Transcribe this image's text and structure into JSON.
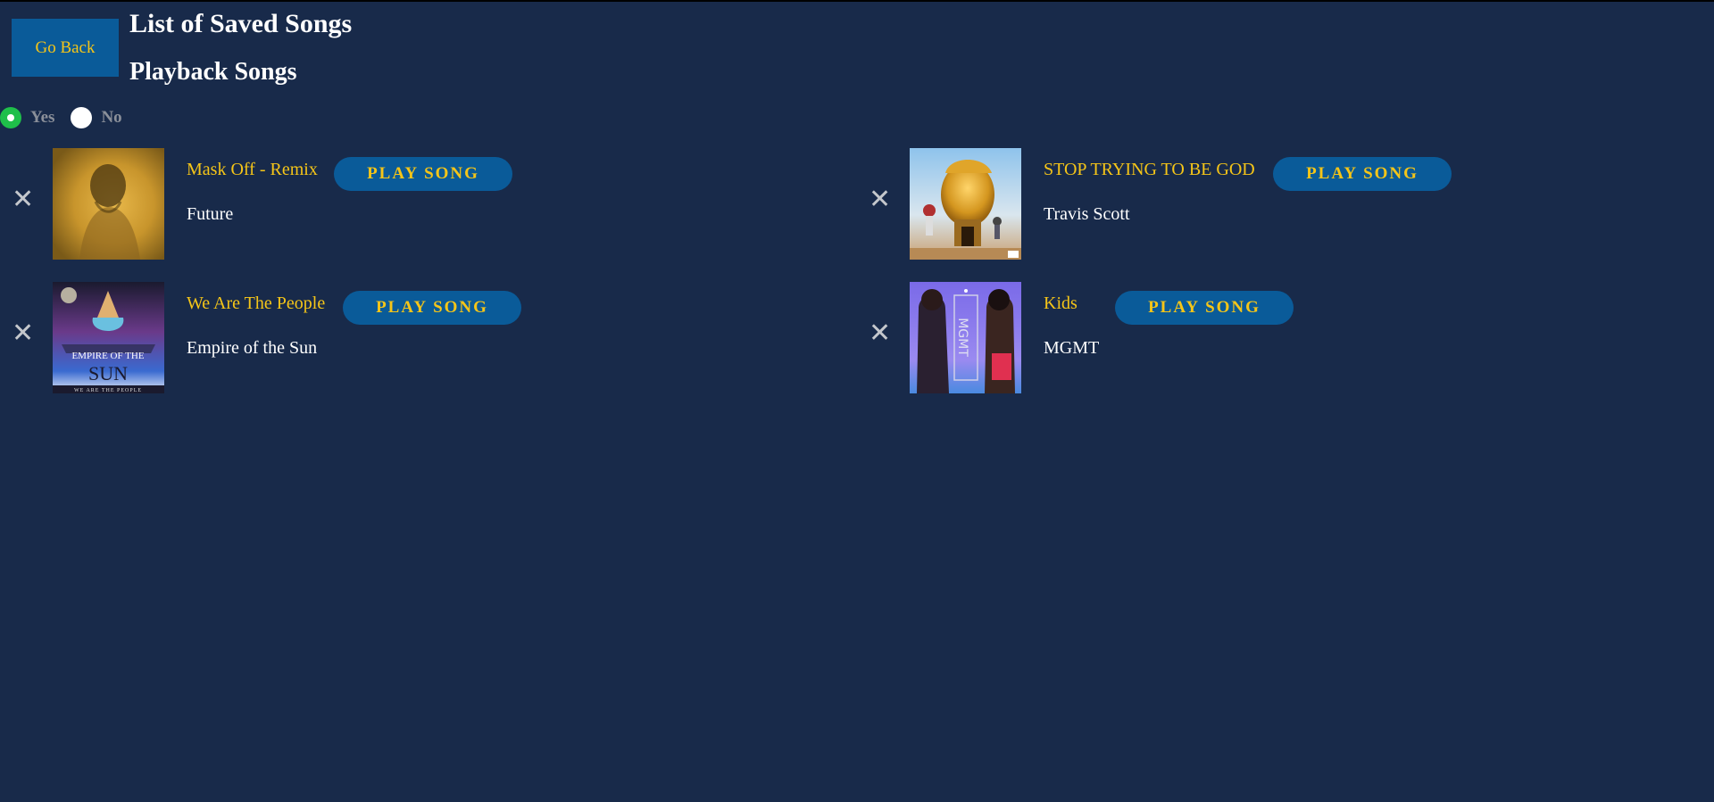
{
  "header": {
    "go_back_label": "Go Back",
    "title": "List of Saved Songs",
    "subtitle": "Playback Songs"
  },
  "playback": {
    "options": [
      {
        "label": "Yes",
        "selected": true
      },
      {
        "label": "No",
        "selected": false
      }
    ]
  },
  "songs": [
    {
      "name": "Mask Off - Remix",
      "artist": "Future",
      "play_label": "PLAY SONG",
      "remove_icon": "close-icon",
      "cover": "album-cover-mask-off"
    },
    {
      "name": "STOP TRYING TO BE GOD",
      "artist": "Travis Scott",
      "play_label": "PLAY SONG",
      "remove_icon": "close-icon",
      "cover": "album-cover-astroworld"
    },
    {
      "name": "We Are The People",
      "artist": "Empire of the Sun",
      "play_label": "PLAY SONG",
      "remove_icon": "close-icon",
      "cover": "album-cover-walking-on-a-dream",
      "cover_text": {
        "line1": "EMPIRE OF THE",
        "line2": "SUN",
        "line3": "WE ARE THE PEOPLE"
      }
    },
    {
      "name": "Kids",
      "artist": "MGMT",
      "play_label": "PLAY SONG",
      "remove_icon": "close-icon",
      "cover": "album-cover-oracular-spectacular",
      "cover_text": {
        "line1": "MGMT"
      }
    }
  ],
  "colors": {
    "background": "#182a4a",
    "accent_blue": "#0a5b99",
    "accent_yellow": "#f5c518",
    "radio_selected": "#1fbf4a"
  }
}
